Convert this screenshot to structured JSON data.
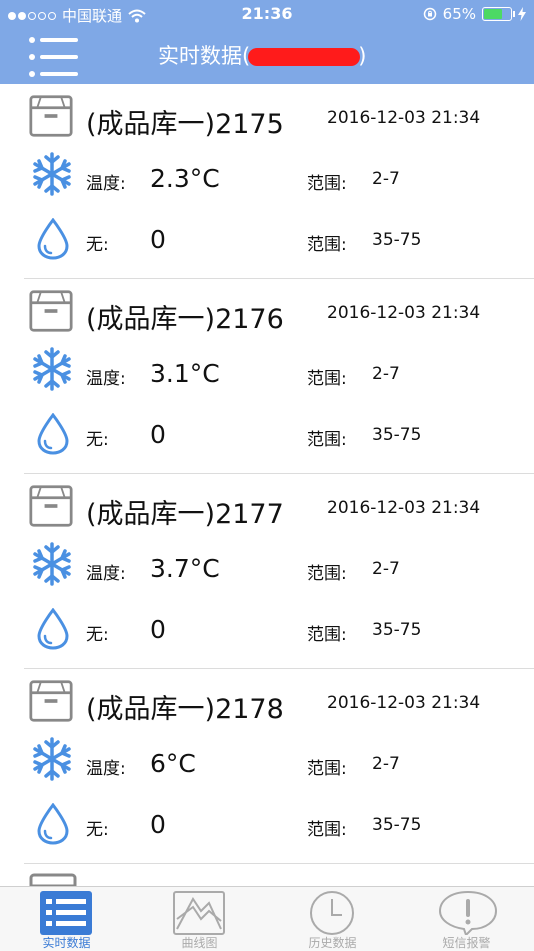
{
  "status_bar": {
    "carrier": "中国联通",
    "time": "21:36",
    "battery": "65%",
    "battery_level": 0.65
  },
  "header": {
    "title_prefix": "实时数据(",
    "title_suffix": ")"
  },
  "items": [
    {
      "name": "(成品库一)2175",
      "time": "2016-12-03 21:34",
      "temp_label": "温度:",
      "temp_value": "2.3°C",
      "temp_range_label": "范围:",
      "temp_range": "2-7",
      "hum_label": "无:",
      "hum_value": "0",
      "hum_range_label": "范围:",
      "hum_range": "35-75"
    },
    {
      "name": "(成品库一)2176",
      "time": "2016-12-03 21:34",
      "temp_label": "温度:",
      "temp_value": "3.1°C",
      "temp_range_label": "范围:",
      "temp_range": "2-7",
      "hum_label": "无:",
      "hum_value": "0",
      "hum_range_label": "范围:",
      "hum_range": "35-75"
    },
    {
      "name": "(成品库一)2177",
      "time": "2016-12-03 21:34",
      "temp_label": "温度:",
      "temp_value": "3.7°C",
      "temp_range_label": "范围:",
      "temp_range": "2-7",
      "hum_label": "无:",
      "hum_value": "0",
      "hum_range_label": "范围:",
      "hum_range": "35-75"
    },
    {
      "name": "(成品库一)2178",
      "time": "2016-12-03 21:34",
      "temp_label": "温度:",
      "temp_value": "6°C",
      "temp_range_label": "范围:",
      "temp_range": "2-7",
      "hum_label": "无:",
      "hum_value": "0",
      "hum_range_label": "范围:",
      "hum_range": "35-75"
    }
  ],
  "tabs": [
    {
      "label": "实时数据",
      "icon": "list-icon",
      "active": true
    },
    {
      "label": "曲线图",
      "icon": "chart-icon",
      "active": false
    },
    {
      "label": "历史数据",
      "icon": "clock-icon",
      "active": false
    },
    {
      "label": "短信报警",
      "icon": "alert-bubble-icon",
      "active": false
    }
  ],
  "colors": {
    "header_bg": "#7fa8e6",
    "icon_blue": "#4a90e2",
    "tab_active": "#3a7bd5",
    "tab_inactive": "#aaaaaa"
  }
}
